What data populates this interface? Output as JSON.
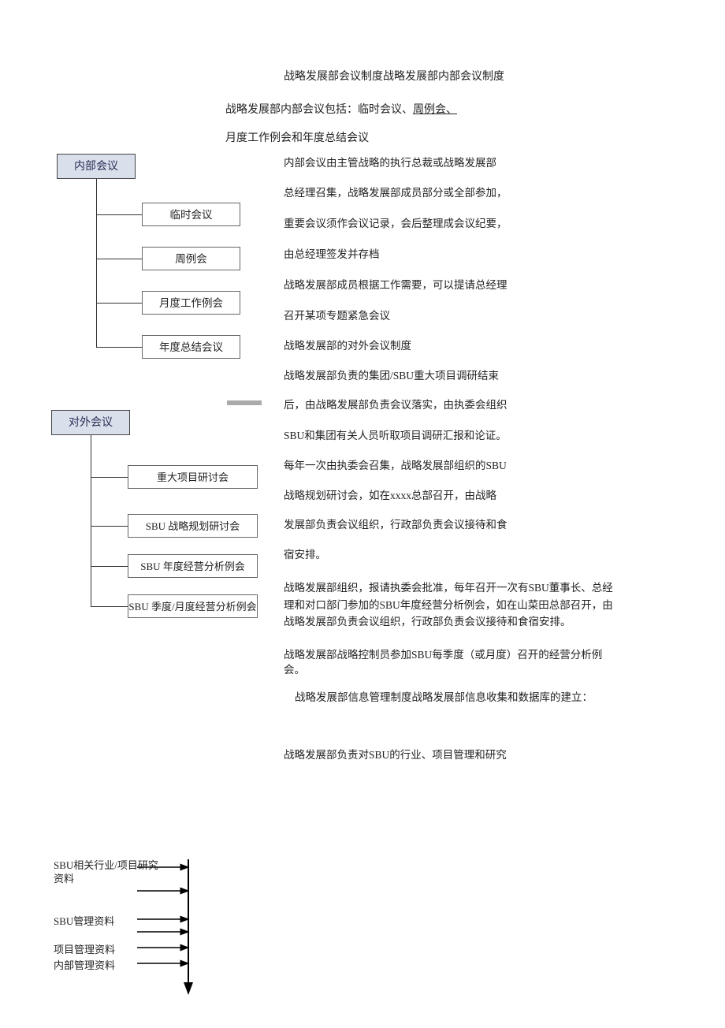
{
  "title": "战略发展部会议制度战略发展部内部会议制度",
  "intro": {
    "line1_prefix": "战略发展部内部会议包括：临时会议、",
    "line1_underlined": "周例会、",
    "line2": "月度工作例会和年度总结会议"
  },
  "diagram1": {
    "head": "内部会议",
    "children": [
      "临时会议",
      "周例会",
      "月度工作例会",
      "年度总结会议"
    ]
  },
  "diagram2": {
    "head": "对外会议",
    "children": [
      "重大项目研讨会",
      "SBU 战略规划研讨会",
      "SBU 年度经营分析例会",
      "SBU 季度/月度经营分析例会"
    ]
  },
  "paragraphs": {
    "p1": "内部会议由主管战略的执行总裁或战略发展部",
    "p2": "总经理召集，战略发展部成员部分或全部参加，",
    "p3": "重要会议须作会议记录，会后整理成会议纪要，",
    "p4": "由总经理签发并存档",
    "p5": "战略发展部成员根据工作需要，可以提请总经理",
    "p6": "召开某项专题紧急会议",
    "p7": "战略发展部的对外会议制度",
    "p8": "战略发展部负责的集团/SBU重大项目调研结束",
    "p9": "后，由战略发展部负责会议落实，由执委会组织",
    "p10": "SBU和集团有关人员听取项目调研汇报和论证。",
    "p11": "每年一次由执委会召集，战略发展部组织的SBU",
    "p12": "战略规划研讨会，如在xxxx总部召开，由战略",
    "p13": "发展部负责会议组织，行政部负责会议接待和食",
    "p14": "宿安排。",
    "p15": "战略发展部组织，报请执委会批准，每年召开一次有SBU董事长、总经理和对口部门参加的SBU年度经营分析例会，如在山菜田总部召开，由战略发展部负责会议组织，行政部负责会议接待和食宿安排。",
    "p16": "战略发展部战略控制员参加SBU每季度（或月度）召开的经营分析例会。",
    "p17": "战略发展部信息管理制度战略发展部信息收集和数据库的建立：",
    "p18": "战略发展部负责对SBU的行业、项目管理和研究"
  },
  "diagram3": {
    "r1": "SBU相关行业/项目研究资料",
    "r2": "SBU管理资料",
    "r3": "项目管理资料",
    "r4": "内部管理资料"
  }
}
